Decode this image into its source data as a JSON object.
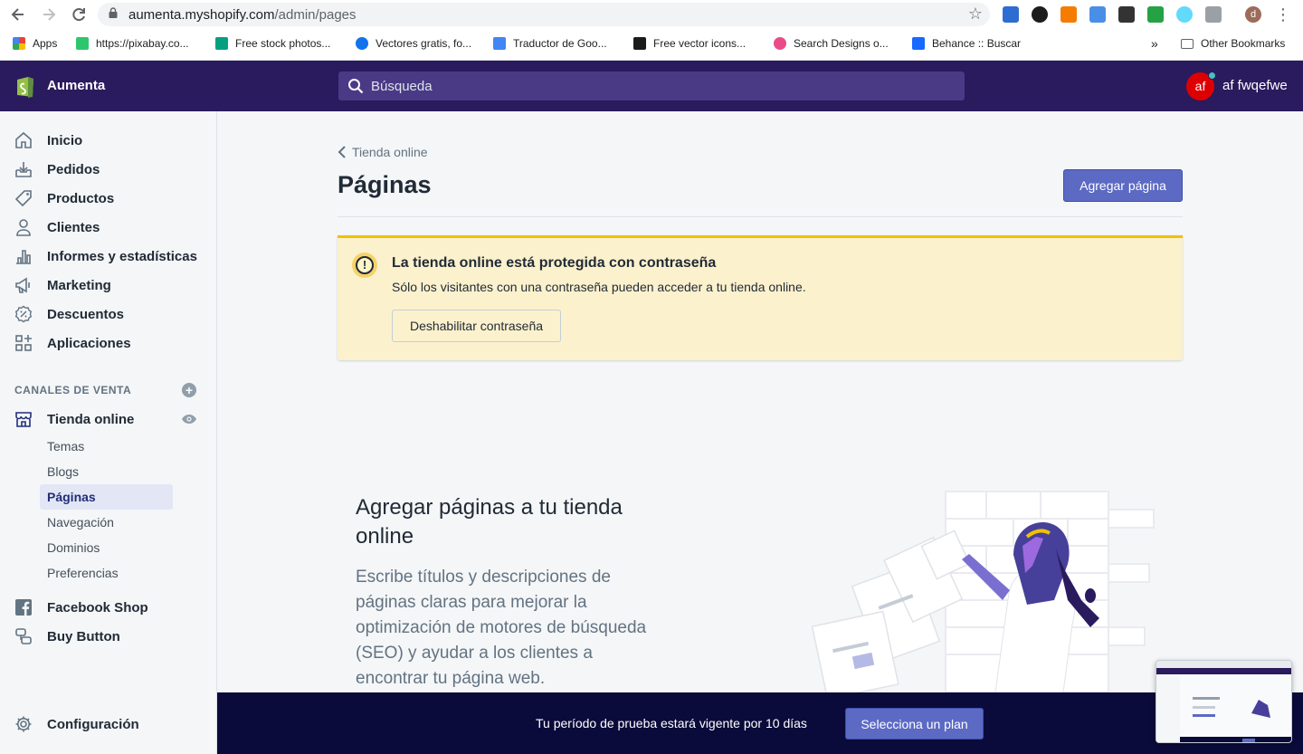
{
  "browser": {
    "url_host": "aumenta.myshopify.com",
    "url_path": "/admin/pages",
    "bookmarks": [
      {
        "label": "Apps",
        "color": "#ea4335"
      },
      {
        "label": "https://pixabay.co...",
        "color": "#2ec66d"
      },
      {
        "label": "Free stock photos...",
        "color": "#05a081"
      },
      {
        "label": "Vectores gratis, fo...",
        "color": "#1273eb"
      },
      {
        "label": "Traductor de Goo...",
        "color": "#4285f4"
      },
      {
        "label": "Free vector icons...",
        "color": "#1b1b1b"
      },
      {
        "label": "Search Designs o...",
        "color": "#ea4c89"
      },
      {
        "label": "Behance :: Buscar",
        "color": "#1769ff"
      }
    ],
    "more_bookmarks": "»",
    "other_bookmarks": "Other Bookmarks",
    "profile_initial": "d"
  },
  "topbar": {
    "store_name": "Aumenta",
    "search_placeholder": "Búsqueda",
    "user_initials": "af",
    "user_name": "af fwqefwe"
  },
  "sidebar": {
    "items": [
      {
        "label": "Inicio",
        "icon": "home-icon"
      },
      {
        "label": "Pedidos",
        "icon": "orders-icon"
      },
      {
        "label": "Productos",
        "icon": "tag-icon"
      },
      {
        "label": "Clientes",
        "icon": "person-icon"
      },
      {
        "label": "Informes y estadísticas",
        "icon": "chart-icon"
      },
      {
        "label": "Marketing",
        "icon": "megaphone-icon"
      },
      {
        "label": "Descuentos",
        "icon": "discount-icon"
      },
      {
        "label": "Aplicaciones",
        "icon": "apps-icon"
      }
    ],
    "channels_title": "CANALES DE VENTA",
    "online_store": "Tienda online",
    "sub_items": [
      "Temas",
      "Blogs",
      "Páginas",
      "Navegación",
      "Dominios",
      "Preferencias"
    ],
    "active_sub": "Páginas",
    "facebook": "Facebook Shop",
    "buy_button": "Buy Button",
    "settings": "Configuración"
  },
  "main": {
    "back_label": "Tienda online",
    "title": "Páginas",
    "add_button": "Agregar página",
    "banner": {
      "title": "La tienda online está protegida con contraseña",
      "text": "Sólo los visitantes con una contraseña pueden acceder a tu tienda online.",
      "button": "Deshabilitar contraseña"
    },
    "empty_title": "Agregar páginas a tu tienda online",
    "empty_text": "Escribe títulos y descripciones de páginas claras para mejorar la optimización de motores de búsqueda (SEO) y ayudar a los clientes a encontrar tu página web."
  },
  "trial": {
    "text": "Tu período de prueba estará vigente por 10 días",
    "button": "Selecciona un plan"
  },
  "colors": {
    "topbar": "#2a1a5e",
    "primary": "#5c6ac4",
    "banner": "#fcf1cd",
    "trial_bar": "#0b0b3b"
  }
}
